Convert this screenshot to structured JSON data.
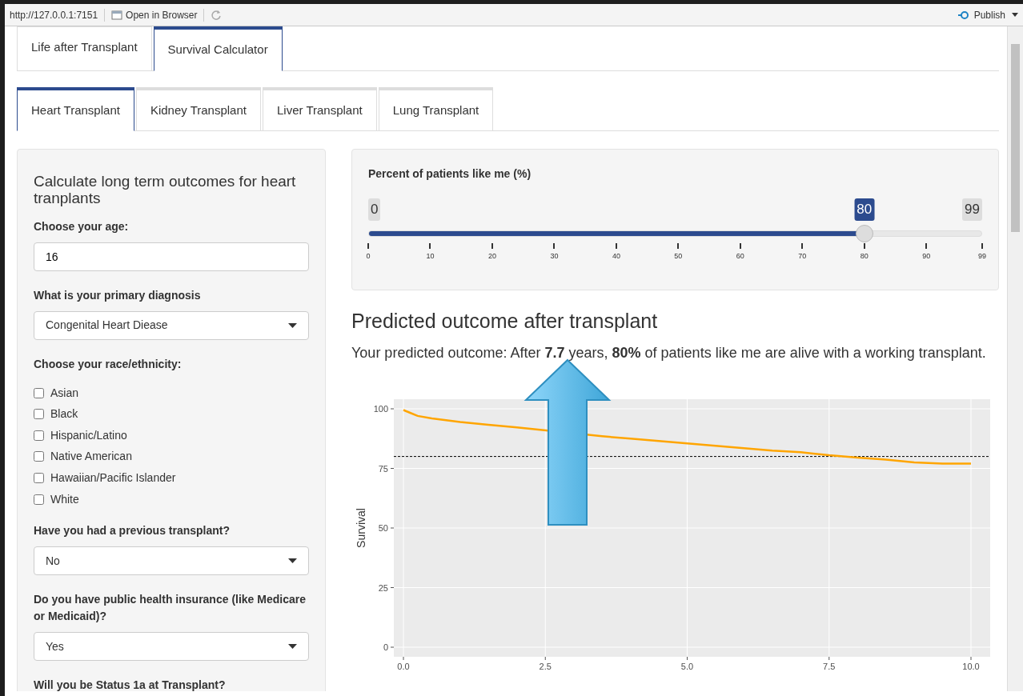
{
  "toolbar": {
    "url": "http://127.0.0.1:7151",
    "open_button": "Open in Browser",
    "publish_button": "Publish"
  },
  "main_tabs": [
    {
      "label": "Life after Transplant",
      "selected": false
    },
    {
      "label": "Survival Calculator",
      "selected": true
    }
  ],
  "organ_tabs": [
    {
      "label": "Heart Transplant",
      "selected": true
    },
    {
      "label": "Kidney Transplant",
      "selected": false
    },
    {
      "label": "Liver Transplant",
      "selected": false
    },
    {
      "label": "Lung Transplant",
      "selected": false
    }
  ],
  "sidebar": {
    "title": "Calculate long term outcomes for heart tranplants",
    "fields": [
      {
        "kind": "number",
        "label": "Choose your age:",
        "value": "16"
      },
      {
        "kind": "select",
        "label": "What is your primary diagnosis",
        "value": "Congenital Heart Diease"
      },
      {
        "kind": "checkboxes",
        "label": "Choose your race/ethnicity:",
        "options": [
          {
            "label": "Asian",
            "checked": false
          },
          {
            "label": "Black",
            "checked": false
          },
          {
            "label": "Hispanic/Latino",
            "checked": false
          },
          {
            "label": "Native American",
            "checked": false
          },
          {
            "label": "Hawaiian/Pacific Islander",
            "checked": false
          },
          {
            "label": "White",
            "checked": false
          }
        ]
      },
      {
        "kind": "select",
        "label": "Have you had a previous transplant?",
        "value": "No"
      },
      {
        "kind": "select",
        "label": "Do you have public health insurance (like Medicare or Medicaid)?",
        "value": "Yes"
      },
      {
        "kind": "heading",
        "label": "Will you be Status 1a at Transplant?"
      }
    ]
  },
  "slider": {
    "label": "Percent of patients like me (%)",
    "min": "0",
    "max": "99",
    "value": "80",
    "level": 0.808,
    "ticks": [
      "0",
      "10",
      "20",
      "30",
      "40",
      "50",
      "60",
      "70",
      "80",
      "90",
      "99"
    ]
  },
  "outcome": {
    "heading": "Predicted outcome after transplant",
    "text": "Your predicted outcome: After **7.7** years, **80%** of patients like me are alive with a working transplant."
  },
  "chart": {
    "chart_data": {
      "type": "line",
      "ylabel": "Survival",
      "xlim": [
        0,
        10
      ],
      "ylim": [
        0,
        100
      ],
      "xticks": [
        {
          "value": 0,
          "label": "0.0"
        },
        {
          "value": 2.5,
          "label": "2.5"
        },
        {
          "value": 5,
          "label": "5.0"
        },
        {
          "value": 7.5,
          "label": "7.5"
        },
        {
          "value": 10,
          "label": "10.0"
        }
      ],
      "yticks": [
        0,
        25,
        50,
        75,
        100
      ],
      "grid": true,
      "x": [
        0,
        0.1,
        0.25,
        0.5,
        1,
        1.5,
        2,
        3.5,
        4,
        4.5,
        5,
        5.5,
        6,
        6.5,
        7,
        7.5,
        8,
        8.5,
        9,
        9.5,
        10
      ],
      "series": [
        {
          "color": "#ffa500",
          "values": [
            99.5,
            98.5,
            97,
            96,
            94.5,
            93.3,
            92.2,
            88.5,
            87.5,
            86.5,
            85.5,
            84.5,
            83.5,
            82.5,
            81.8,
            80.5,
            79.5,
            78.7,
            77.5,
            77,
            77
          ]
        }
      ],
      "ref_lines": [
        {
          "axis": "y",
          "value": 80
        }
      ]
    }
  }
}
